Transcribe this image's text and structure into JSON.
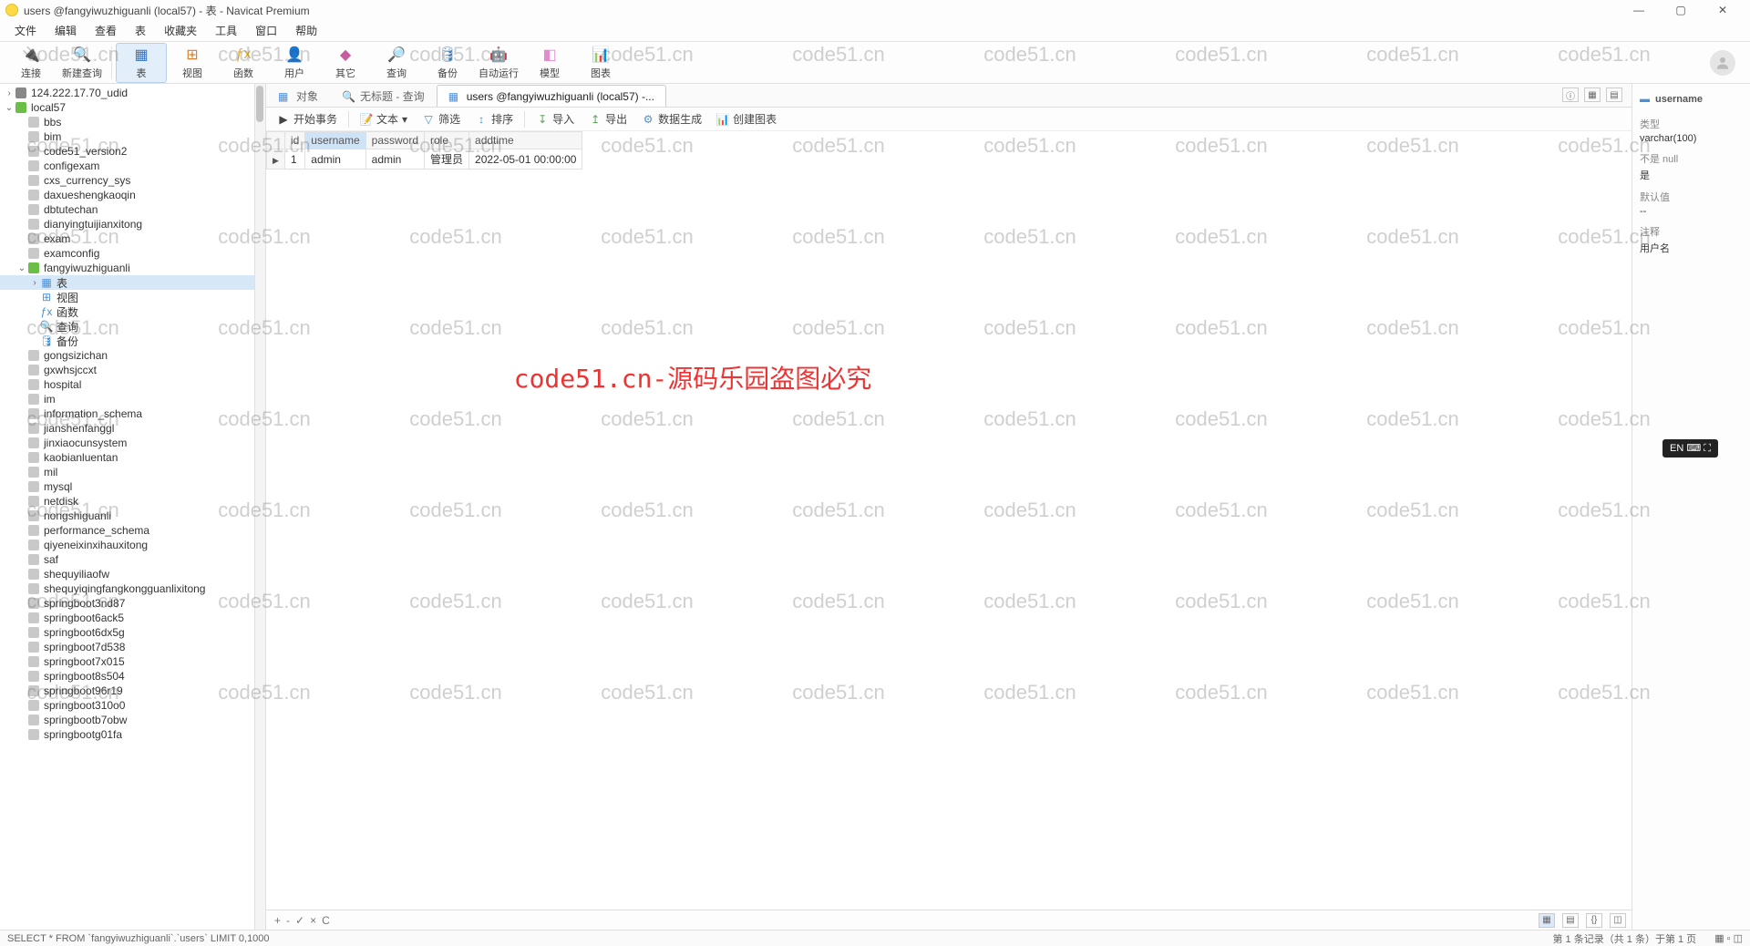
{
  "title": "users @fangyiwuzhiguanli (local57) - 表 - Navicat Premium",
  "menu": [
    "文件",
    "编辑",
    "查看",
    "表",
    "收藏夹",
    "工具",
    "窗口",
    "帮助"
  ],
  "toolbar": [
    {
      "label": "连接",
      "icon": "plug",
      "color": "#f2a52a"
    },
    {
      "label": "新建查询",
      "icon": "query",
      "color": "#3b74c1"
    },
    {
      "label": "表",
      "icon": "table",
      "color": "#3b74c1",
      "active": true
    },
    {
      "label": "视图",
      "icon": "view",
      "color": "#d87f2f"
    },
    {
      "label": "函数",
      "icon": "fx",
      "color": "#e0ae2d"
    },
    {
      "label": "用户",
      "icon": "user",
      "color": "#5f7fbf"
    },
    {
      "label": "其它",
      "icon": "other",
      "color": "#c65d9e"
    },
    {
      "label": "查询",
      "icon": "search",
      "color": "#3b85c1"
    },
    {
      "label": "备份",
      "icon": "backup",
      "color": "#5393d0"
    },
    {
      "label": "自动运行",
      "icon": "auto",
      "color": "#4fb3c7"
    },
    {
      "label": "模型",
      "icon": "model",
      "color": "#e48bd0"
    },
    {
      "label": "图表",
      "icon": "chart",
      "color": "#7870c8"
    }
  ],
  "connections": [
    {
      "name": "124.222.17.70_udid",
      "type": "conn",
      "expanded": false,
      "level": 0
    },
    {
      "name": "local57",
      "type": "conn-active",
      "expanded": true,
      "level": 0
    }
  ],
  "databases": [
    "bbs",
    "bim",
    "code51_version2",
    "configexam",
    "cxs_currency_sys",
    "daxueshengkaoqin",
    "dbtutechan",
    "dianyingtuijianxitong",
    "exam",
    "examconfig"
  ],
  "active_db": {
    "name": "fangyiwuzhiguanli",
    "children": [
      {
        "name": "表",
        "icon": "table",
        "expanded": true,
        "selected": true
      },
      {
        "name": "视图",
        "icon": "view"
      },
      {
        "name": "函数",
        "icon": "fx"
      },
      {
        "name": "查询",
        "icon": "query"
      },
      {
        "name": "备份",
        "icon": "backup"
      }
    ]
  },
  "databases2": [
    "gongsizichan",
    "gxwhsjccxt",
    "hospital",
    "im",
    "information_schema",
    "jianshenfanggl",
    "jinxiaocunsystem",
    "kaobianluentan",
    "mil",
    "mysql",
    "netdisk",
    "nongshiguanli",
    "performance_schema",
    "qiyeneixinxihauxitong",
    "saf",
    "shequyiliaofw",
    "shequyiqingfangkongguanlixitong",
    "springboot3nd87",
    "springboot6ack5",
    "springboot6dx5g",
    "springboot7d538",
    "springboot7x015",
    "springboot8s504",
    "springboot96r19",
    "springboot310o0",
    "springbootb7obw",
    "springbootg01fa"
  ],
  "tabs": [
    {
      "label": "对象",
      "active": false,
      "icon": "grid"
    },
    {
      "label": "无标题 - 查询",
      "active": false,
      "icon": "query"
    },
    {
      "label": "users @fangyiwuzhiguanli (local57) -...",
      "active": true,
      "icon": "table"
    }
  ],
  "subtoolbar": {
    "begin": "开始事务",
    "text": "文本",
    "filter": "筛选",
    "sort": "排序",
    "import": "导入",
    "export": "导出",
    "gen": "数据生成",
    "chart": "创建图表"
  },
  "columns": [
    "id",
    "username",
    "password",
    "role",
    "addtime"
  ],
  "selected_col_index": 1,
  "rows": [
    {
      "id": "1",
      "username": "admin",
      "password": "admin",
      "role": "管理员",
      "addtime": "2022-05-01 00:00:00"
    }
  ],
  "footer_nav": [
    "+",
    "-",
    "✓",
    "×",
    "C"
  ],
  "footer_record": "第 1 条记录（共 1 条）于第 1 页",
  "sql": "SELECT * FROM `fangyiwuzhiguanli`.`users` LIMIT 0,1000",
  "right_panel": {
    "field": "username",
    "type_label": "类型",
    "type_value": "varchar(100)",
    "null_label": "不是 null",
    "null_value": "是",
    "default_label": "默认值",
    "default_value": "--",
    "comment_label": "注释",
    "comment_value": "用户名"
  },
  "center_watermark": "code51.cn-源码乐园盗图必究",
  "wm_text": "code51.cn",
  "lang_badge": "EN ⌨ ⛶",
  "right_icons": [
    "ⓘ",
    "▦",
    "▤"
  ]
}
